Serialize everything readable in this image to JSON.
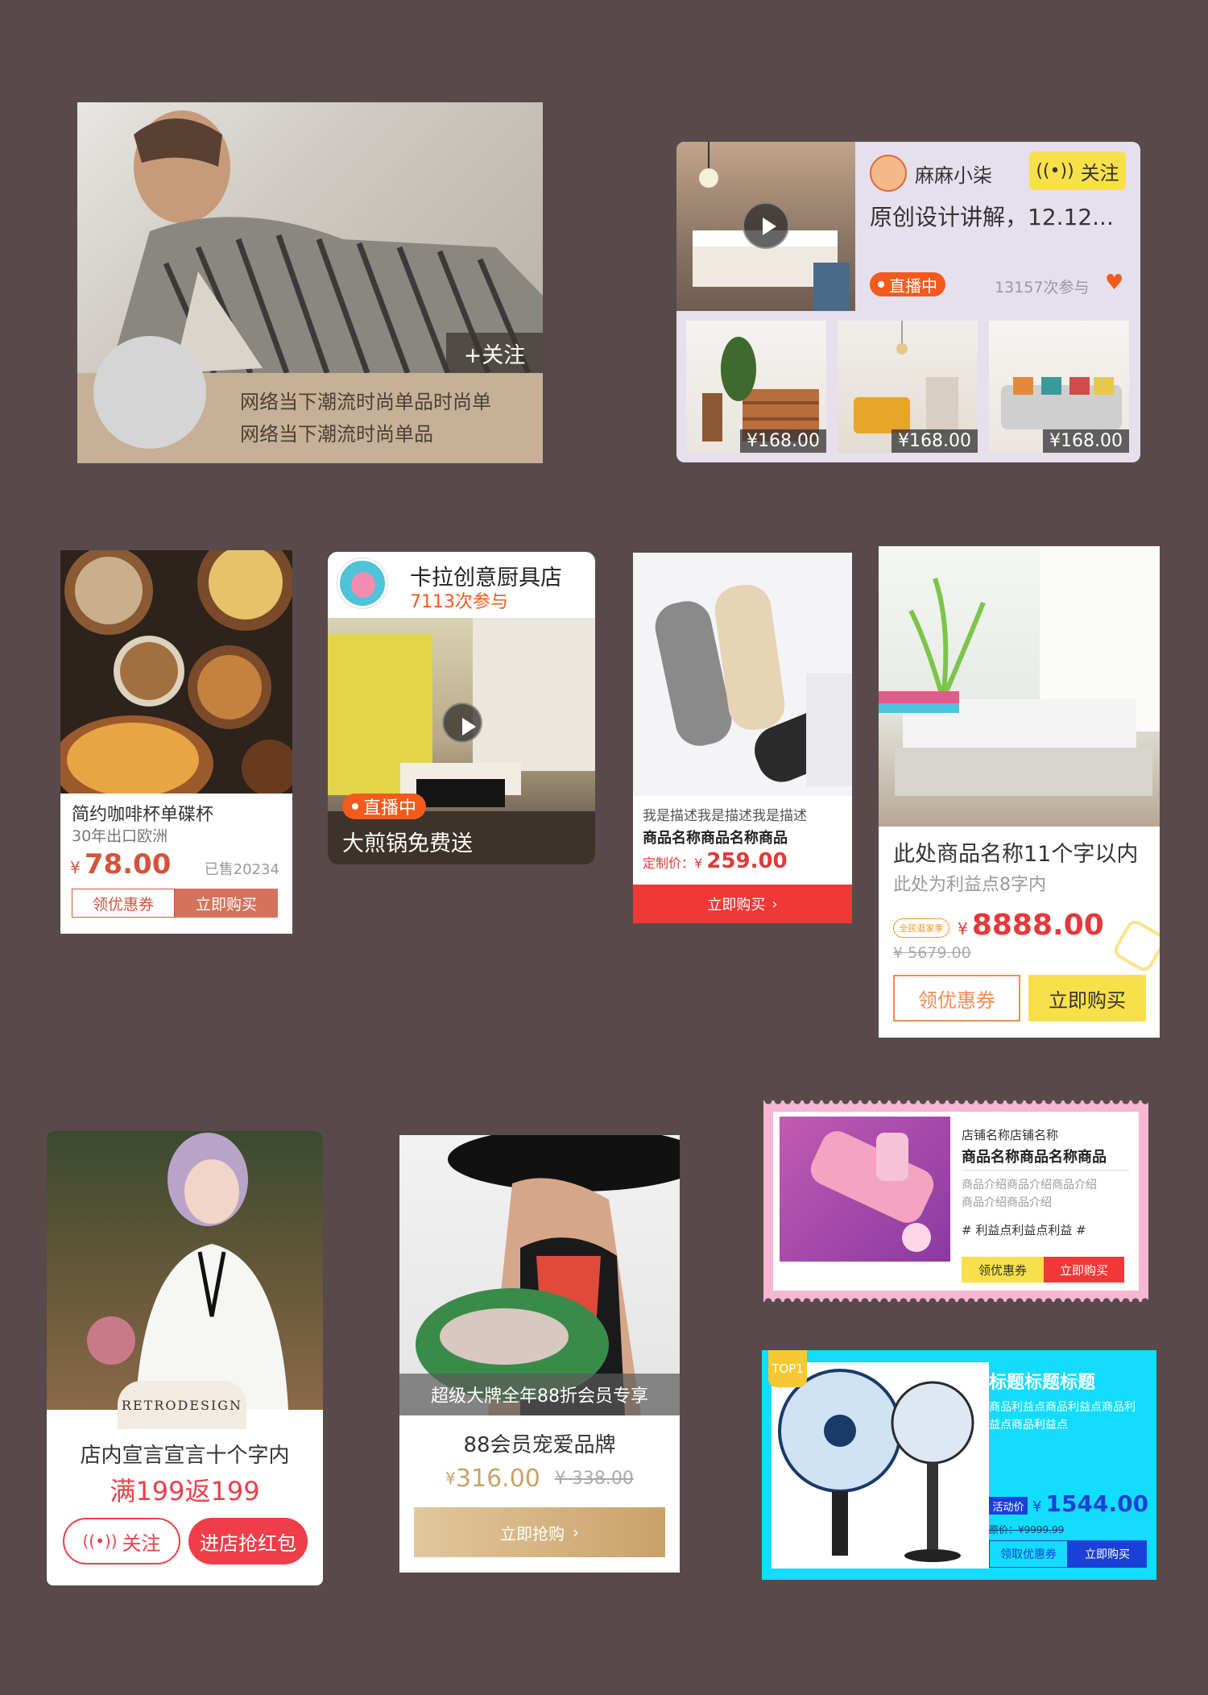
{
  "c1": {
    "follow": "+关注",
    "desc_line1": "网络当下潮流时尚单品时尚单",
    "desc_line2": "网络当下潮流时尚单品"
  },
  "c2": {
    "name": "麻麻小柒",
    "follow": "关注",
    "title": "原创设计讲解，12.12...",
    "live": "直播中",
    "participants": "13157次参与",
    "thumbs": [
      {
        "price": "¥168.00"
      },
      {
        "price": "¥168.00"
      },
      {
        "price": "¥168.00"
      }
    ]
  },
  "c3": {
    "title": "简约咖啡杯单碟杯",
    "subtitle": "30年出口欧洲",
    "currency": "¥",
    "price": "78.00",
    "sold": "已售20234",
    "coupon": "领优惠券",
    "buy": "立即购买"
  },
  "c4": {
    "shop": "卡拉创意厨具店",
    "participants": "7113次参与",
    "live": "直播中",
    "caption": "大煎锅免费送"
  },
  "c5": {
    "desc": "我是描述我是描述我是描述",
    "name": "商品名称商品名称商品",
    "price_label": "定制价：",
    "currency": "¥",
    "price": "259.00",
    "buy": "立即购买"
  },
  "c6": {
    "name": "此处商品名称11个字以内",
    "benefit": "此处为利益点8字内",
    "badge": "全民逛家季",
    "currency": "¥",
    "price": "8888.00",
    "old_price": "¥ 5679.00",
    "coupon": "领优惠券",
    "buy": "立即购买"
  },
  "c7": {
    "logo": "RETRODESIGN",
    "slogan": "店内宣言宣言十个字内",
    "promo": "满199返199",
    "follow": "关注",
    "redpack": "进店抢红包"
  },
  "c8": {
    "banner": "超级大牌全年88折会员专享",
    "title": "88会员宠爱品牌",
    "currency": "¥",
    "price": "316.00",
    "old_price": "¥ 338.00",
    "buy": "立即抢购"
  },
  "c9": {
    "shop": "店铺名称店铺名称",
    "name": "商品名称商品名称商品",
    "intro_line1": "商品介绍商品介绍商品介绍",
    "intro_line2": "商品介绍商品介绍",
    "benefit": "# 利益点利益点利益 #",
    "coupon": "领优惠券",
    "buy": "立即购买"
  },
  "c10": {
    "rank": "TOP1",
    "title": "标题标题标题",
    "benefit_line1": "商品利益点商品利益点商品利",
    "benefit_line2": "益点商品利益点",
    "activity": "活动价",
    "currency": "¥",
    "price": "1544.00",
    "old_price": "原价：¥9999.99",
    "coupon": "领取优惠券",
    "buy": "立即购买"
  },
  "colors": {
    "background": "#584a4a",
    "live_orange": "#f35a1c",
    "price_red": "#e5383b",
    "yellow": "#f8e04a",
    "cyan": "#12dcff",
    "pink": "#f7b6d2"
  },
  "icons": [
    "play-icon",
    "broadcast-icon",
    "heart-icon",
    "chevron-right-icon"
  ]
}
